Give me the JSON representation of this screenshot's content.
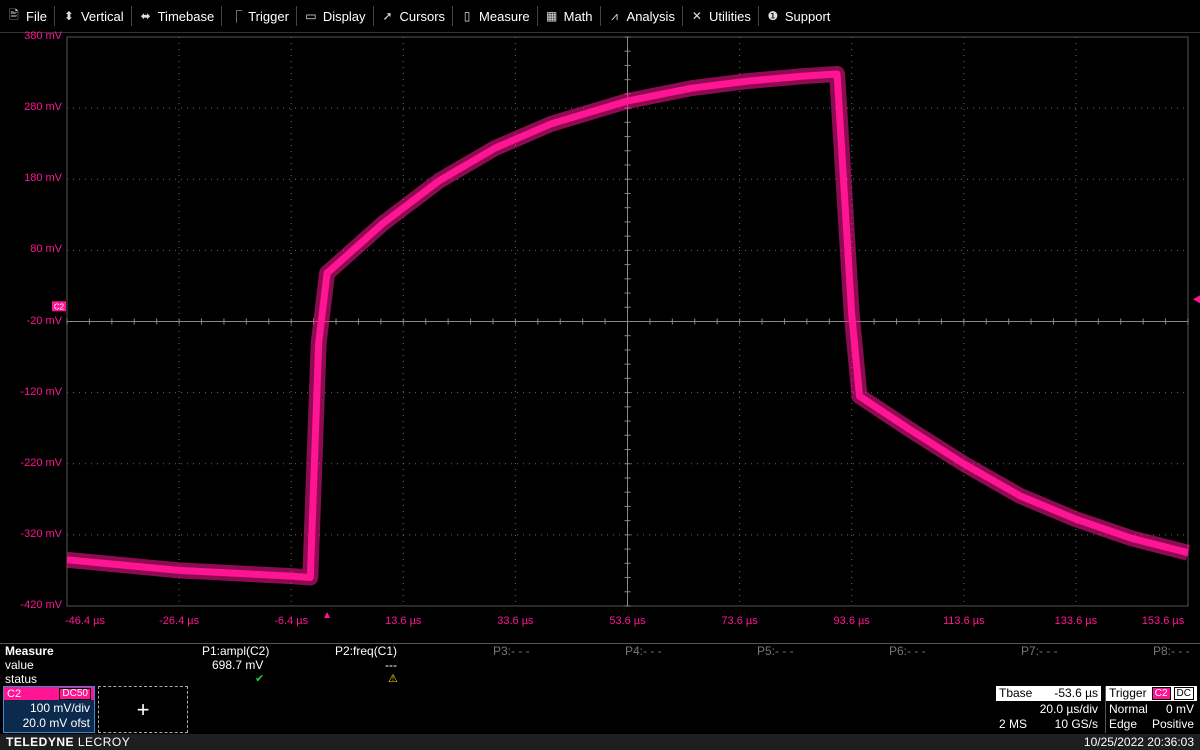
{
  "menu": [
    {
      "label": "File",
      "icon": "file-icon",
      "glyph": "🖹"
    },
    {
      "label": "Vertical",
      "icon": "vertical-arrows-icon",
      "glyph": "⬍"
    },
    {
      "label": "Timebase",
      "icon": "horizontal-arrows-icon",
      "glyph": "⬌"
    },
    {
      "label": "Trigger",
      "icon": "trigger-icon",
      "glyph": "⎾"
    },
    {
      "label": "Display",
      "icon": "display-icon",
      "glyph": "▭"
    },
    {
      "label": "Cursors",
      "icon": "cursors-icon",
      "glyph": "➚"
    },
    {
      "label": "Measure",
      "icon": "measure-icon",
      "glyph": "▯"
    },
    {
      "label": "Math",
      "icon": "math-icon",
      "glyph": "▦"
    },
    {
      "label": "Analysis",
      "icon": "analysis-icon",
      "glyph": "⩘"
    },
    {
      "label": "Utilities",
      "icon": "utilities-icon",
      "glyph": "✕"
    },
    {
      "label": "Support",
      "icon": "support-icon",
      "glyph": "❶"
    }
  ],
  "chart_data": {
    "type": "line",
    "y_tick_labels": [
      "380 mV",
      "280 mV",
      "180 mV",
      "80 mV",
      "-20 mV",
      "-120 mV",
      "-220 mV",
      "-320 mV",
      "-420 mV"
    ],
    "x_tick_labels": [
      "-46.4 µs",
      "-26.4 µs",
      "-6.4 µs",
      "13.6 µs",
      "33.6 µs",
      "53.6 µs",
      "73.6 µs",
      "93.6 µs",
      "113.6 µs",
      "133.6 µs",
      "153.6 µs"
    ],
    "xlim": [
      -46.4,
      153.6
    ],
    "ylim": [
      -420,
      380
    ],
    "x_unit": "µs",
    "y_unit": "mV",
    "grid": true,
    "trace_color": "#ff1493",
    "series": [
      {
        "channel_marker": "C2",
        "points": [
          [
            -46.4,
            -355
          ],
          [
            -26.4,
            -370
          ],
          [
            -6.4,
            -378
          ],
          [
            -3.0,
            -380
          ],
          [
            -1.5,
            -50
          ],
          [
            0.0,
            48
          ],
          [
            10,
            118
          ],
          [
            20,
            178
          ],
          [
            30,
            224
          ],
          [
            40,
            258
          ],
          [
            53.6,
            290
          ],
          [
            65,
            308
          ],
          [
            75,
            318
          ],
          [
            85,
            325
          ],
          [
            91.0,
            328
          ],
          [
            93.6,
            -10
          ],
          [
            95.0,
            -125
          ],
          [
            103.6,
            -170
          ],
          [
            113.6,
            -220
          ],
          [
            123.6,
            -265
          ],
          [
            133.6,
            -298
          ],
          [
            143.6,
            -325
          ],
          [
            153.6,
            -345
          ]
        ]
      }
    ]
  },
  "measure": {
    "title": "Measure",
    "params": [
      {
        "label": "P1:ampl(C2)",
        "value": "698.7 mV",
        "status": "ok"
      },
      {
        "label": "P2:freq(C1)",
        "value": "---",
        "status": "warn"
      },
      {
        "label": "P3:- - -",
        "value": "",
        "status": ""
      },
      {
        "label": "P4:- - -",
        "value": "",
        "status": ""
      },
      {
        "label": "P5:- - -",
        "value": "",
        "status": ""
      },
      {
        "label": "P6:- - -",
        "value": "",
        "status": ""
      },
      {
        "label": "P7:- - -",
        "value": "",
        "status": ""
      },
      {
        "label": "P8:- - -",
        "value": "",
        "status": ""
      }
    ],
    "row_value": "value",
    "row_status": "status"
  },
  "channel": {
    "name": "C2",
    "coupling": "DC50",
    "vdiv": "100 mV/div",
    "offset": "20.0 mV ofst",
    "color": "#ff1493"
  },
  "add_label": "+",
  "timebase": {
    "label": "Tbase",
    "delay": "-53.6 µs",
    "tdiv": "20.0 µs/div",
    "memory": "2 MS",
    "rate": "10 GS/s"
  },
  "trigger": {
    "label": "Trigger",
    "source": "C2",
    "coupling": "DC",
    "mode": "Normal",
    "level": "0 mV",
    "type": "Edge",
    "slope": "Positive"
  },
  "footer": {
    "brand_bold": "TELEDYNE",
    "brand_rest": " LECROY",
    "datetime": "10/25/2022 20:36:03"
  }
}
